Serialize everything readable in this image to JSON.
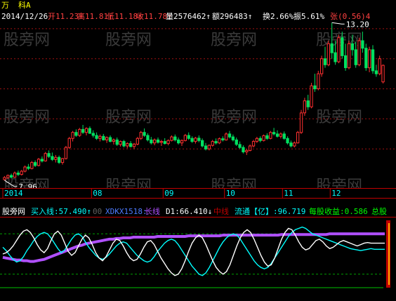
{
  "header": {
    "title_glyph": "万",
    "stock_name": "科A",
    "date": "2014/12/26",
    "fields": [
      {
        "label": "开",
        "value": "11.23",
        "arrow": "↑",
        "color": "#ff4040"
      },
      {
        "label": "高",
        "value": "11.81",
        "arrow": "↑",
        "color": "#ff4040"
      },
      {
        "label": "低",
        "value": "11.18",
        "arrow": "↑",
        "color": "#ff4040"
      },
      {
        "label": "收",
        "value": "11.78",
        "arrow": "↑",
        "color": "#ff4040"
      },
      {
        "label": "量",
        "value": "2576462",
        "arrow": "↑",
        "color": "#ffffff"
      },
      {
        "label": "额",
        "value": "296483",
        "arrow": "↑",
        "color": "#ffffff"
      },
      {
        "label": "换",
        "value": "2.66%",
        "arrow": "",
        "color": "#ffffff"
      },
      {
        "label": "振",
        "value": "5.61%",
        "arrow": "",
        "color": "#ffffff"
      },
      {
        "label": "张",
        "value": "(0.56)",
        "arrow": "4",
        "color": "#ff4040"
      }
    ]
  },
  "indicator_bar": {
    "name": "股旁网",
    "items": [
      {
        "label": "买入线:",
        "value": "57.490",
        "suffix": "↑",
        "color": "#00ffff"
      },
      {
        "label": "",
        "value": "00",
        "suffix": "",
        "color": "#606060"
      },
      {
        "label": "XDKX1518:",
        "value": "",
        "suffix": "",
        "color": "#4d7bff"
      },
      {
        "label": "长线",
        "value": "",
        "suffix": "",
        "color": "#b050ff"
      },
      {
        "label": "D1:",
        "value": "66.410",
        "suffix": "↓",
        "color": "#ffffff"
      },
      {
        "label": "中线",
        "value": "",
        "suffix": "",
        "color": "#c00000"
      },
      {
        "label": "流通【亿】:",
        "value": "96.719",
        "suffix": "",
        "color": "#00ffff"
      },
      {
        "label": "每股收益:",
        "value": "0.586",
        "suffix": "",
        "color": "#00ff00"
      },
      {
        "label": "总股",
        "value": "",
        "suffix": "",
        "color": "#00ff00"
      }
    ]
  },
  "watermarks": [
    "股旁网",
    "股旁网",
    "股旁网",
    "股旁网",
    "股旁网",
    "股旁网",
    "股旁网",
    "股旁网",
    "股旁网",
    "股旁网",
    "股旁网",
    "股旁网"
  ],
  "colors": {
    "up": "#ff3030",
    "down": "#00e060",
    "grid": "#a01010",
    "axis": "#c00000",
    "axis_text": "#00ffff"
  },
  "chart_data": [
    {
      "type": "candlestick",
      "x_tick_labels": [
        "2014",
        "08",
        "09",
        "10",
        "11",
        "12"
      ],
      "annotations": [
        {
          "text": "7.96",
          "kind": "low"
        },
        {
          "text": "13.20",
          "kind": "high"
        }
      ],
      "ylim": [
        7.7,
        13.3
      ],
      "candles": [
        [
          7.98,
          8.1,
          7.96,
          8.05
        ],
        [
          8.05,
          8.15,
          8.0,
          8.12
        ],
        [
          8.12,
          8.18,
          8.02,
          8.06
        ],
        [
          8.06,
          8.25,
          8.04,
          8.2
        ],
        [
          8.2,
          8.28,
          8.1,
          8.15
        ],
        [
          8.15,
          8.3,
          8.12,
          8.26
        ],
        [
          8.26,
          8.45,
          8.22,
          8.4
        ],
        [
          8.4,
          8.5,
          8.3,
          8.35
        ],
        [
          8.35,
          8.6,
          8.32,
          8.55
        ],
        [
          8.55,
          8.62,
          8.4,
          8.45
        ],
        [
          8.45,
          8.7,
          8.42,
          8.66
        ],
        [
          8.66,
          8.75,
          8.55,
          8.6
        ],
        [
          8.6,
          8.9,
          8.58,
          8.85
        ],
        [
          8.85,
          8.95,
          8.7,
          8.75
        ],
        [
          8.75,
          8.88,
          8.6,
          8.65
        ],
        [
          8.65,
          8.8,
          8.55,
          8.72
        ],
        [
          8.72,
          8.78,
          8.5,
          8.55
        ],
        [
          8.55,
          8.7,
          8.48,
          8.68
        ],
        [
          8.68,
          9.1,
          8.65,
          9.05
        ],
        [
          9.05,
          9.4,
          9.0,
          9.35
        ],
        [
          9.35,
          9.6,
          9.25,
          9.55
        ],
        [
          9.55,
          9.65,
          9.4,
          9.45
        ],
        [
          9.45,
          9.7,
          9.4,
          9.65
        ],
        [
          9.65,
          9.8,
          9.5,
          9.55
        ],
        [
          9.55,
          9.72,
          9.45,
          9.68
        ],
        [
          9.68,
          9.75,
          9.5,
          9.52
        ],
        [
          9.52,
          9.62,
          9.38,
          9.45
        ],
        [
          9.45,
          9.55,
          9.3,
          9.35
        ],
        [
          9.35,
          9.48,
          9.25,
          9.42
        ],
        [
          9.42,
          9.5,
          9.28,
          9.3
        ],
        [
          9.3,
          9.42,
          9.2,
          9.38
        ],
        [
          9.38,
          9.45,
          9.22,
          9.25
        ],
        [
          9.25,
          9.35,
          9.15,
          9.3
        ],
        [
          9.3,
          9.38,
          9.1,
          9.15
        ],
        [
          9.15,
          9.28,
          9.08,
          9.25
        ],
        [
          9.25,
          9.3,
          9.05,
          9.1
        ],
        [
          9.1,
          9.22,
          9.02,
          9.18
        ],
        [
          9.18,
          9.26,
          9.05,
          9.08
        ],
        [
          9.08,
          9.2,
          9.0,
          9.16
        ],
        [
          9.16,
          9.4,
          9.12,
          9.35
        ],
        [
          9.35,
          9.6,
          9.3,
          9.55
        ],
        [
          9.55,
          9.68,
          9.4,
          9.45
        ],
        [
          9.45,
          9.52,
          9.25,
          9.3
        ],
        [
          9.3,
          9.4,
          9.15,
          9.2
        ],
        [
          9.2,
          9.35,
          9.12,
          9.3
        ],
        [
          9.3,
          9.38,
          9.18,
          9.22
        ],
        [
          9.22,
          9.3,
          9.1,
          9.25
        ],
        [
          9.25,
          9.36,
          9.15,
          9.18
        ],
        [
          9.18,
          9.32,
          9.12,
          9.28
        ],
        [
          9.28,
          9.45,
          9.25,
          9.4
        ],
        [
          9.4,
          9.48,
          9.25,
          9.3
        ],
        [
          9.3,
          9.38,
          9.15,
          9.2
        ],
        [
          9.2,
          9.32,
          9.1,
          9.28
        ],
        [
          9.28,
          9.5,
          9.25,
          9.45
        ],
        [
          9.45,
          9.55,
          9.3,
          9.35
        ],
        [
          9.35,
          9.42,
          9.2,
          9.25
        ],
        [
          9.25,
          9.4,
          9.18,
          9.36
        ],
        [
          9.36,
          9.45,
          9.22,
          9.28
        ],
        [
          9.28,
          9.35,
          9.05,
          9.1
        ],
        [
          9.1,
          9.2,
          8.95,
          9.0
        ],
        [
          9.0,
          9.15,
          8.95,
          9.12
        ],
        [
          9.12,
          9.3,
          9.08,
          9.25
        ],
        [
          9.25,
          9.35,
          9.15,
          9.2
        ],
        [
          9.2,
          9.38,
          9.16,
          9.34
        ],
        [
          9.34,
          9.42,
          9.25,
          9.3
        ],
        [
          9.3,
          9.55,
          9.28,
          9.5
        ],
        [
          9.5,
          9.6,
          9.35,
          9.4
        ],
        [
          9.4,
          9.48,
          9.25,
          9.3
        ],
        [
          9.3,
          9.38,
          9.1,
          9.15
        ],
        [
          9.15,
          9.25,
          9.0,
          9.05
        ],
        [
          9.05,
          9.12,
          8.85,
          8.9
        ],
        [
          8.9,
          9.0,
          8.8,
          8.95
        ],
        [
          8.95,
          9.15,
          8.92,
          9.1
        ],
        [
          9.1,
          9.3,
          9.05,
          9.25
        ],
        [
          9.25,
          9.4,
          9.2,
          9.35
        ],
        [
          9.35,
          9.42,
          9.22,
          9.28
        ],
        [
          9.28,
          9.48,
          9.25,
          9.44
        ],
        [
          9.44,
          9.52,
          9.3,
          9.35
        ],
        [
          9.35,
          9.6,
          9.32,
          9.55
        ],
        [
          9.55,
          9.7,
          9.45,
          9.5
        ],
        [
          9.5,
          9.62,
          9.38,
          9.42
        ],
        [
          9.42,
          9.55,
          9.35,
          9.5
        ],
        [
          9.5,
          9.58,
          9.3,
          9.35
        ],
        [
          9.35,
          9.42,
          9.15,
          9.2
        ],
        [
          9.2,
          9.28,
          9.05,
          9.1
        ],
        [
          9.1,
          9.25,
          9.05,
          9.2
        ],
        [
          9.2,
          9.6,
          9.18,
          9.55
        ],
        [
          9.55,
          10.3,
          9.5,
          10.2
        ],
        [
          10.2,
          10.7,
          10.1,
          10.6
        ],
        [
          10.6,
          10.8,
          10.3,
          10.4
        ],
        [
          10.4,
          11.2,
          10.35,
          11.1
        ],
        [
          11.1,
          11.5,
          10.9,
          11.0
        ],
        [
          11.0,
          11.6,
          10.95,
          11.5
        ],
        [
          11.5,
          12.1,
          11.4,
          12.0
        ],
        [
          12.0,
          12.4,
          11.7,
          11.8
        ],
        [
          11.8,
          12.6,
          11.75,
          12.5
        ],
        [
          12.5,
          13.2,
          12.0,
          12.2
        ],
        [
          12.2,
          12.6,
          11.8,
          11.9
        ],
        [
          11.9,
          12.8,
          11.85,
          12.7
        ],
        [
          12.7,
          12.9,
          12.0,
          12.1
        ],
        [
          12.1,
          12.5,
          11.6,
          11.7
        ],
        [
          11.7,
          12.6,
          11.65,
          12.5
        ],
        [
          12.5,
          12.8,
          12.1,
          12.3
        ],
        [
          12.3,
          12.55,
          11.7,
          11.8
        ],
        [
          11.8,
          12.7,
          11.75,
          12.6
        ],
        [
          12.6,
          12.9,
          12.2,
          12.35
        ],
        [
          12.35,
          12.5,
          11.6,
          11.7
        ],
        [
          11.7,
          12.4,
          11.55,
          12.3
        ],
        [
          12.3,
          12.45,
          11.5,
          11.6
        ],
        [
          11.6,
          11.8,
          11.4,
          11.5
        ],
        [
          11.5,
          12.1,
          11.45,
          12.0
        ],
        [
          11.23,
          11.81,
          11.18,
          11.78
        ]
      ]
    },
    {
      "type": "line",
      "ylim": [
        0,
        100
      ],
      "reference_levels": [
        80,
        20,
        0
      ],
      "series": [
        {
          "name": "长线",
          "color": "#b050ff",
          "values": [
            45,
            44,
            43,
            42,
            41,
            41,
            40,
            40,
            39,
            39,
            40,
            41,
            42,
            44,
            46,
            48,
            50,
            52,
            54,
            56,
            58,
            60,
            62,
            63,
            65,
            66,
            67,
            68,
            69,
            70,
            71,
            72,
            72,
            73,
            73,
            74,
            74,
            74,
            75,
            75,
            75,
            75,
            75,
            75,
            75,
            76,
            76,
            76,
            76,
            76,
            76,
            76,
            76,
            76,
            77,
            77,
            77,
            77,
            77,
            77,
            77,
            77,
            77,
            77,
            78,
            78,
            78,
            78,
            78,
            78,
            78,
            78,
            78,
            78,
            78,
            78,
            78,
            78,
            78,
            78,
            78,
            79,
            79,
            79,
            79,
            79,
            79,
            79,
            79,
            79,
            79,
            79,
            79,
            79,
            79,
            80,
            80,
            80,
            80,
            80,
            80,
            80,
            80,
            80,
            80,
            80,
            80,
            80,
            80,
            80,
            80,
            80
          ]
        },
        {
          "name": "买入线",
          "color": "#00ffff",
          "values": [
            60,
            55,
            48,
            42,
            38,
            40,
            46,
            55,
            62,
            70,
            76,
            80,
            82,
            80,
            74,
            66,
            58,
            52,
            56,
            64,
            72,
            78,
            80,
            76,
            68,
            60,
            54,
            48,
            44,
            42,
            45,
            50,
            56,
            62,
            66,
            68,
            66,
            60,
            54,
            48,
            44,
            40,
            38,
            40,
            46,
            54,
            60,
            66,
            70,
            72,
            70,
            64,
            56,
            48,
            40,
            32,
            26,
            20,
            18,
            22,
            30,
            40,
            50,
            60,
            68,
            74,
            78,
            80,
            78,
            72,
            64,
            56,
            48,
            40,
            34,
            30,
            28,
            30,
            36,
            44,
            52,
            60,
            68,
            76,
            82,
            86,
            88,
            90,
            88,
            84,
            80,
            78,
            76,
            74,
            72,
            70,
            68,
            66,
            64,
            62,
            60,
            58,
            57,
            56,
            55,
            56,
            57,
            58,
            57,
            57,
            57,
            57
          ]
        },
        {
          "name": "D1",
          "color": "#ffffff",
          "values": [
            50,
            52,
            56,
            62,
            70,
            78,
            84,
            86,
            82,
            74,
            64,
            56,
            52,
            58,
            70,
            80,
            84,
            78,
            66,
            54,
            48,
            52,
            62,
            72,
            78,
            74,
            64,
            52,
            44,
            40,
            46,
            56,
            66,
            72,
            70,
            62,
            52,
            44,
            40,
            42,
            50,
            60,
            68,
            70,
            64,
            54,
            44,
            36,
            28,
            22,
            18,
            20,
            28,
            40,
            54,
            66,
            74,
            78,
            74,
            64,
            52,
            40,
            30,
            24,
            20,
            24,
            34,
            48,
            62,
            74,
            82,
            86,
            82,
            72,
            60,
            48,
            38,
            32,
            34,
            44,
            58,
            72,
            82,
            88,
            86,
            78,
            68,
            60,
            56,
            58,
            64,
            70,
            72,
            68,
            62,
            58,
            60,
            64,
            68,
            70,
            68,
            66,
            64,
            62,
            64,
            66,
            67,
            66,
            66,
            66,
            66,
            66
          ]
        }
      ]
    }
  ]
}
